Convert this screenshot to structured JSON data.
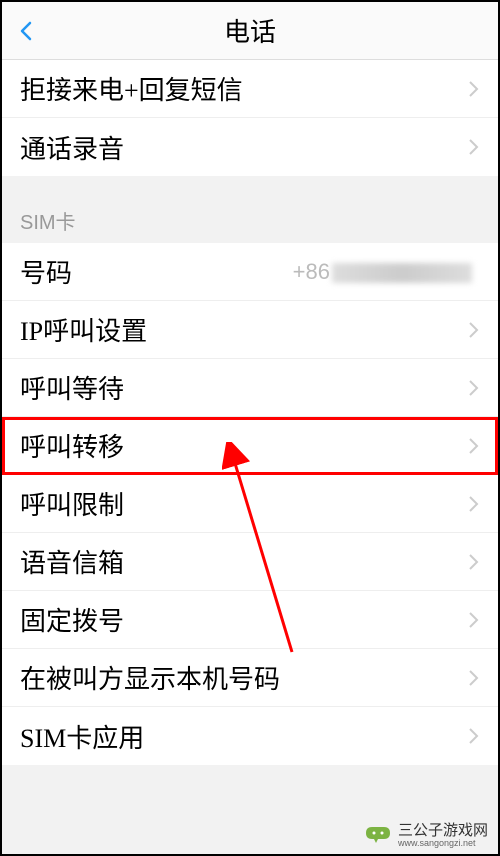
{
  "header": {
    "title": "电话"
  },
  "group1": {
    "items": [
      {
        "label": "拒接来电+回复短信"
      },
      {
        "label": "通话录音"
      }
    ]
  },
  "section_sim": {
    "header": "SIM卡",
    "items": [
      {
        "label": "号码",
        "value_prefix": "+86"
      },
      {
        "label": "IP呼叫设置"
      },
      {
        "label": "呼叫等待"
      },
      {
        "label": "呼叫转移"
      },
      {
        "label": "呼叫限制"
      },
      {
        "label": "语音信箱"
      },
      {
        "label": "固定拨号"
      },
      {
        "label": "在被叫方显示本机号码"
      },
      {
        "label": "SIM卡应用"
      }
    ]
  },
  "watermark": {
    "text": "三公子游戏网",
    "sub": "www.sangongzi.net"
  }
}
